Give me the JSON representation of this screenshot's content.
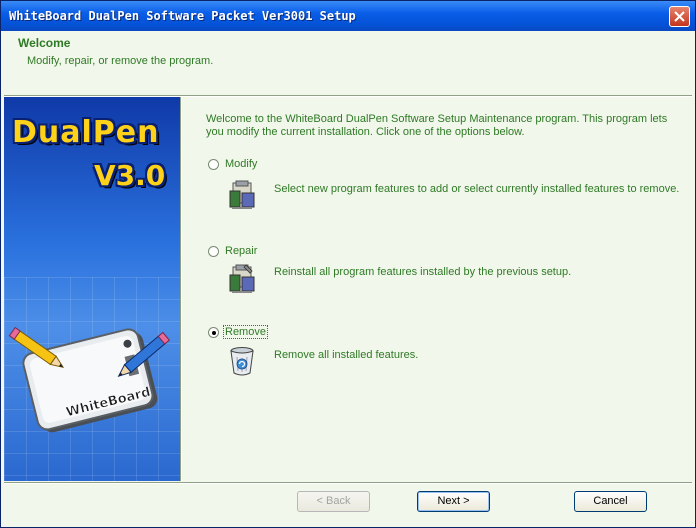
{
  "window": {
    "title": "WhiteBoard DualPen Software Packet Ver3001 Setup"
  },
  "header": {
    "title": "Welcome",
    "subtitle": "Modify, repair, or remove the program."
  },
  "banner": {
    "product": "DualPen",
    "version": "V3.0",
    "device_label": "WhiteBoard"
  },
  "main": {
    "intro": "Welcome to the WhiteBoard DualPen Software Setup Maintenance program. This program lets you modify the current installation. Click one of the options below.",
    "options": [
      {
        "label": "Modify",
        "description": "Select new program features to add or select currently installed features to remove.",
        "icon": "modify-package-icon",
        "selected": false
      },
      {
        "label": "Repair",
        "description": "Reinstall all program features installed by the previous setup.",
        "icon": "repair-package-icon",
        "selected": false
      },
      {
        "label": "Remove",
        "description": "Remove all installed features.",
        "icon": "recycle-bin-icon",
        "selected": true
      }
    ]
  },
  "footer": {
    "back_label": "< Back",
    "next_label": "Next >",
    "cancel_label": "Cancel"
  },
  "colors": {
    "text_green": "#2f7a26",
    "background": "#f1f7ea",
    "titlebar_blue": "#0452d6"
  }
}
